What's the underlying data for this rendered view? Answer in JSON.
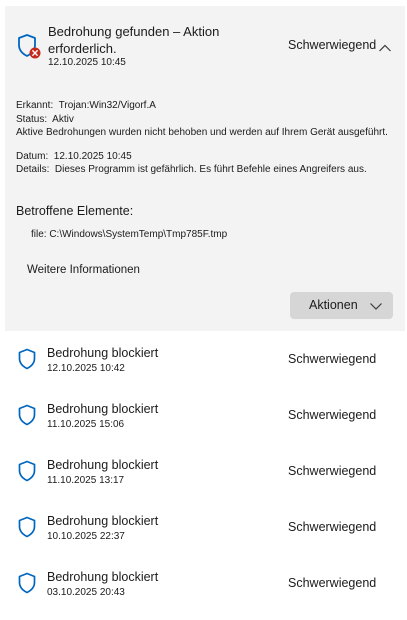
{
  "expanded": {
    "title": "Bedrohung gefunden – Aktion erforderlich.",
    "date": "12.10.2025 10:45",
    "severity": "Schwerwiegend",
    "details": {
      "detected_label": "Erkannt:",
      "detected_value": "Trojan:Win32/Vigorf.A",
      "status_label": "Status:",
      "status_value": "Aktiv",
      "status_desc": "Aktive Bedrohungen wurden nicht behoben und werden auf Ihrem Gerät ausgeführt.",
      "date_label": "Datum:",
      "date_value": "12.10.2025 10:45",
      "details_label": "Details:",
      "details_value": "Dieses Programm ist gefährlich. Es führt Befehle eines Angreifers aus."
    },
    "affected_title": "Betroffene Elemente:",
    "file": "file: C:\\Windows\\SystemTemp\\Tmp785F.tmp",
    "more_info": "Weitere Informationen",
    "actions_label": "Aktionen"
  },
  "threats": [
    {
      "title": "Bedrohung blockiert",
      "date": "12.10.2025 10:42",
      "severity": "Schwerwiegend"
    },
    {
      "title": "Bedrohung blockiert",
      "date": "11.10.2025 15:06",
      "severity": "Schwerwiegend"
    },
    {
      "title": "Bedrohung blockiert",
      "date": "11.10.2025 13:17",
      "severity": "Schwerwiegend"
    },
    {
      "title": "Bedrohung blockiert",
      "date": "10.10.2025 22:37",
      "severity": "Schwerwiegend"
    },
    {
      "title": "Bedrohung blockiert",
      "date": "03.10.2025 20:43",
      "severity": "Schwerwiegend"
    }
  ],
  "colors": {
    "accent": "#0067c0",
    "alert": "#c42b1c",
    "panel": "#f3f3f3",
    "button": "#d6d6d6"
  },
  "icons": {
    "header": "shield-alert-icon",
    "item": "shield-icon",
    "collapse": "chevron-up-icon",
    "dropdown": "chevron-down-icon"
  }
}
